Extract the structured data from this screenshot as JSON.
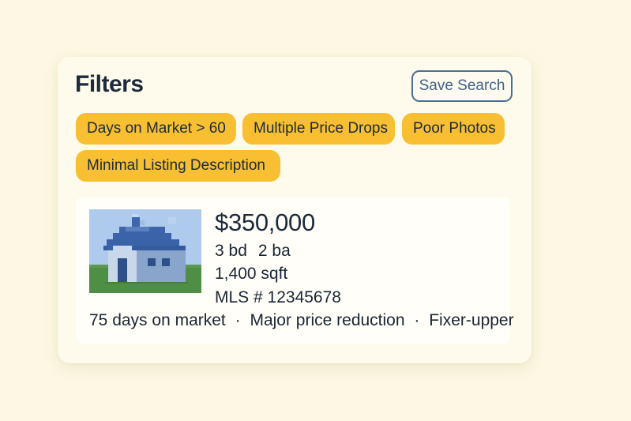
{
  "filters": {
    "title": "Filters",
    "save_label": "Save Search",
    "chips": [
      {
        "label": "Days on Market > 60"
      },
      {
        "label": "Multiple Price Drops"
      },
      {
        "label": "Poor Photos"
      },
      {
        "label": "Minimal Listing Description"
      }
    ]
  },
  "listing": {
    "thumbnail_icon": "house-icon",
    "price": "$350,000",
    "beds": "3 bd",
    "baths": "2 ba",
    "sqft": "1,400 sqft",
    "mls": "MLS # 12345678",
    "tags": [
      "75 days on market",
      "Major price reduction",
      "Fixer-upper"
    ],
    "separator": "·"
  },
  "colors": {
    "background": "#fdf8e4",
    "chip": "#f7bf31",
    "save_border": "#4a6f96",
    "text": "#1d2a3a"
  }
}
